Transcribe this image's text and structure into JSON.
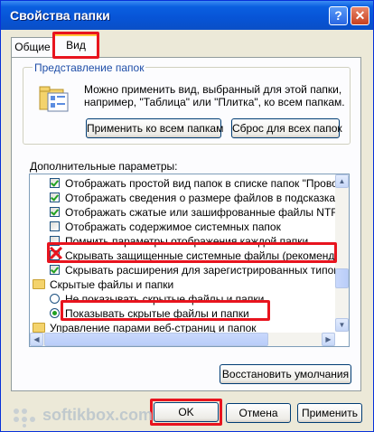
{
  "window": {
    "title": "Свойства папки",
    "help_glyph": "?",
    "close_glyph": "✕"
  },
  "tabs": [
    {
      "label": "Общие"
    },
    {
      "label": "Вид"
    }
  ],
  "folder_views": {
    "group_title": "Представление папок",
    "description": "Можно применить вид, выбранный для этой папки, например, \"Таблица\" или \"Плитка\", ко всем папкам.",
    "apply_all_label": "Применить ко всем папкам",
    "reset_all_label": "Сброс для всех папок"
  },
  "advanced": {
    "label": "Дополнительные параметры:",
    "items": [
      {
        "type": "checkbox",
        "checked": true,
        "indent": 1,
        "label": "Отображать простой вид папок в списке папок \"Проводни"
      },
      {
        "type": "checkbox",
        "checked": true,
        "indent": 1,
        "label": "Отображать сведения о размере файлов в подсказках па"
      },
      {
        "type": "checkbox",
        "checked": true,
        "indent": 1,
        "label": "Отображать сжатые или зашифрованные файлы NTFS др"
      },
      {
        "type": "checkbox",
        "checked": false,
        "indent": 1,
        "label": "Отображать содержимое системных папок"
      },
      {
        "type": "checkbox",
        "checked": false,
        "indent": 1,
        "label": "Помнить параметры отображения каждой папки"
      },
      {
        "type": "checkbox",
        "checked": false,
        "indent": 1,
        "label": "Скрывать защищенные системные файлы (рекомендуетс"
      },
      {
        "type": "checkbox",
        "checked": true,
        "indent": 1,
        "label": "Скрывать расширения для зарегистрированных типов фа"
      },
      {
        "type": "folder",
        "indent": 0,
        "label": "Скрытые файлы и папки"
      },
      {
        "type": "radio",
        "selected": false,
        "indent": 1,
        "label": "Не показывать скрытые файлы и папки"
      },
      {
        "type": "radio",
        "selected": true,
        "indent": 1,
        "label": "Показывать скрытые файлы и папки"
      },
      {
        "type": "folder",
        "indent": 0,
        "label": "Управление парами веб-страниц и папок"
      }
    ],
    "restore_defaults_label": "Восстановить умолчания"
  },
  "buttons": {
    "ok_label": "OK",
    "cancel_label": "Отмена",
    "apply_label": "Применить"
  },
  "watermark": {
    "text": "softikbox.com"
  },
  "colors": {
    "highlight": "#e8141e",
    "titlebar": "#0754d6",
    "group_title": "#1f4ea8"
  }
}
